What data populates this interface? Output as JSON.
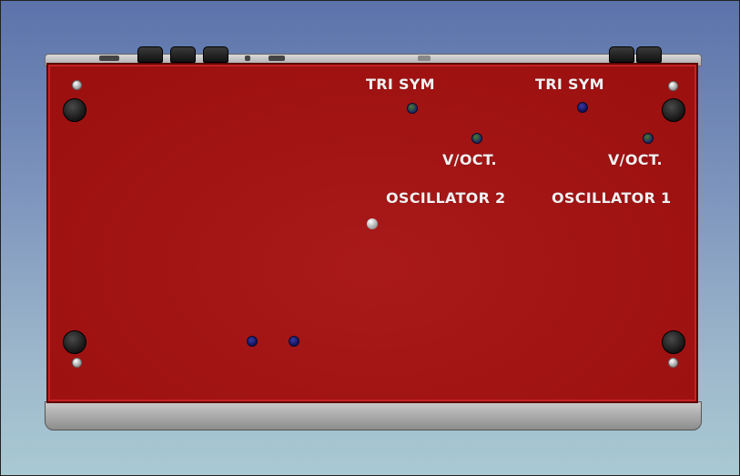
{
  "panel": {
    "labels": {
      "osc2_tri_sym": "TRI SYM",
      "osc1_tri_sym": "TRI SYM",
      "osc2_voct": "V/OCT.",
      "osc1_voct": "V/OCT.",
      "osc2_title": "OSCILLATOR 2",
      "osc1_title": "OSCILLATOR 1"
    }
  },
  "colors": {
    "panel": "#a51010",
    "background_top": "#5b73aa",
    "background_bottom": "#a9c9d3",
    "label_text": "#f3f0f0"
  },
  "icons": {
    "trimmer": "trim-pot-icon",
    "foot": "rubber-foot-icon",
    "screw": "screw-icon",
    "jack": "audio-jack-icon"
  }
}
